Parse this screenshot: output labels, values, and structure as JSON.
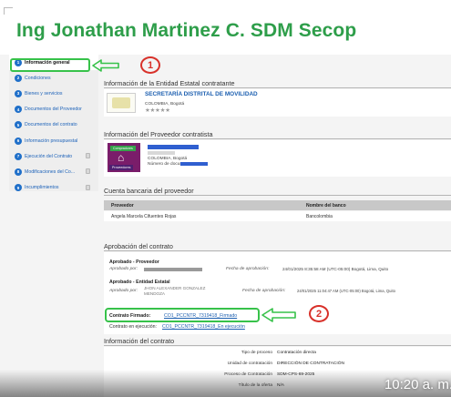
{
  "slide_title": "Ing Jonathan Martinez C. SDM Secop",
  "sidebar": {
    "items": [
      {
        "num": "1",
        "label": "Información general",
        "active": true,
        "locked": false
      },
      {
        "num": "2",
        "label": "Condiciones",
        "active": false,
        "locked": false
      },
      {
        "num": "3",
        "label": "Bienes y servicios",
        "active": false,
        "locked": false
      },
      {
        "num": "4",
        "label": "Documentos del Proveedor",
        "active": false,
        "locked": false
      },
      {
        "num": "5",
        "label": "Documentos del contrato",
        "active": false,
        "locked": false
      },
      {
        "num": "6",
        "label": "Información presupuestal",
        "active": false,
        "locked": false
      },
      {
        "num": "7",
        "label": "Ejecución del Contrato",
        "active": false,
        "locked": true
      },
      {
        "num": "8",
        "label": "Modificaciones del Co...",
        "active": false,
        "locked": true
      },
      {
        "num": "9",
        "label": "Incumplimientos",
        "active": false,
        "locked": true
      }
    ]
  },
  "annotations": {
    "marker_1": "1",
    "marker_2": "2"
  },
  "entity_section": {
    "title": "Información de la Entidad Estatal contratante",
    "name": "SECRETARÍA DISTRITAL DE MOVILIDAD",
    "location": "COLOMBIA, Bogotá",
    "stars": "★★★★★"
  },
  "provider_section": {
    "title": "Información del Proveedor contratista",
    "badge_top": "Compradores",
    "badge_bottom": "Proveedores",
    "location": "COLOMBIA, Bogotá",
    "doc_label": "Número de documento"
  },
  "bank_section": {
    "title": "Cuenta bancaria del proveedor",
    "headers": [
      "Proveedor",
      "Nombre del banco"
    ],
    "row": [
      "Angela Marcela Cifuentes Rojas",
      "Bancolombia"
    ]
  },
  "approval_section": {
    "title": "Aprobación del contrato",
    "provider_heading": "Aprobado  -  Proveedor",
    "provider_by_label": "Aprobado por:",
    "provider_date_label": "Fecha de aprobación:",
    "provider_date": "24/01/2025 8:35:58 AM (UTC-05:00) Bogotá, Lima, Quito",
    "entity_heading": "Aprobado  -  Entidad Estatal",
    "entity_by_label": "Aprobado por:",
    "entity_by": "JHON ALEXANDER GONZALEZ MENDOZA",
    "entity_date_label": "Fecha de aprobación:",
    "entity_date": "24/01/2025 11:04:47 AM (UTC-05:00) Bogotá, Lima, Quito",
    "signed_label": "Contrato Firmado:",
    "signed_link": "CO1_PCCNTR_7319418_Firmado",
    "execution_label": "Contrato en ejecución:",
    "execution_link": "CO1_PCCNTR_7319418_En ejecución"
  },
  "contract_section": {
    "title": "Información del contrato",
    "fields": [
      {
        "label": "Tipo de proceso",
        "value": "Contratación directa"
      },
      {
        "label": "Unidad de contratación",
        "value": "DIRECCIÓN DE CONTRATACIÓN"
      },
      {
        "label": "Proceso de Contratación",
        "value": "SDM-CPS-69-2025"
      },
      {
        "label": "Título de la oferta",
        "value": "N/A"
      }
    ]
  },
  "timestamp": "10:20 a. m."
}
